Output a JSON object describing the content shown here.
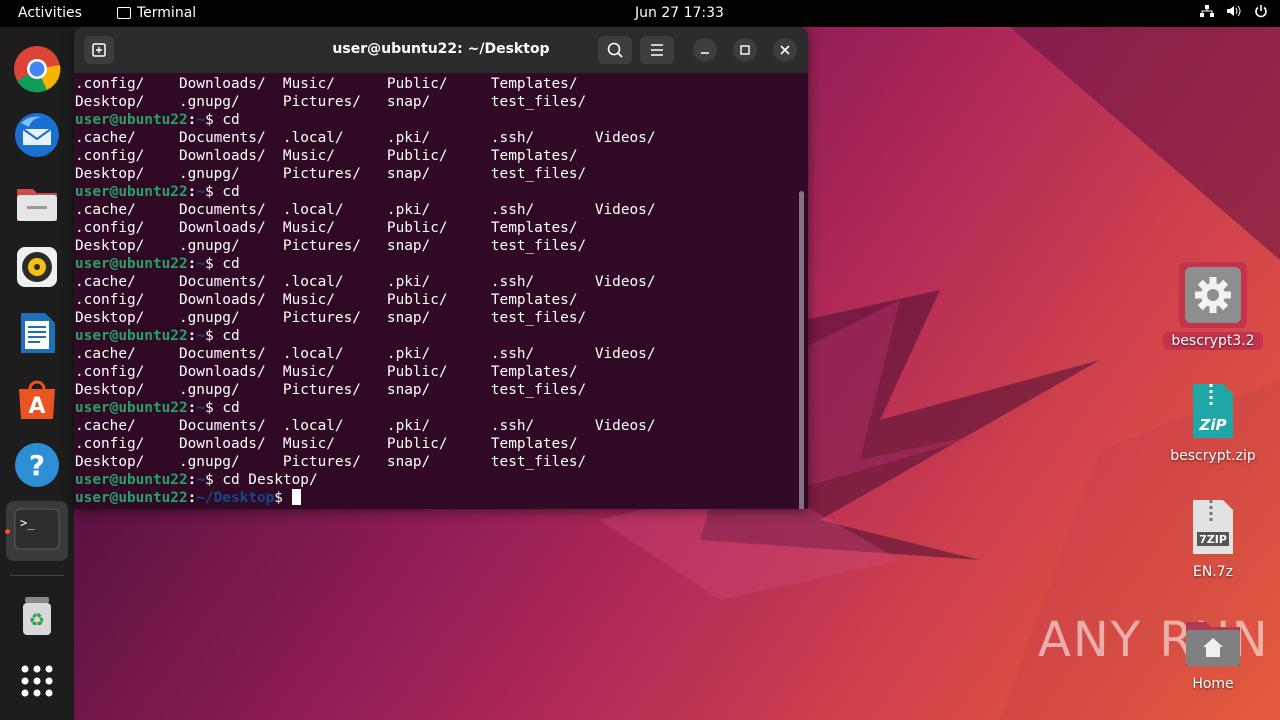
{
  "topbar": {
    "activities": "Activities",
    "app_name": "Terminal",
    "clock": "Jun 27  17:33",
    "tray_icons": [
      "network-icon",
      "volume-icon",
      "power-icon"
    ]
  },
  "dock": {
    "items": [
      "chrome",
      "thunderbird",
      "files",
      "rhythmbox",
      "libreoffice-writer",
      "app-center",
      "help",
      "terminal",
      "trash",
      "show-apps"
    ]
  },
  "terminal": {
    "title": "user@ubuntu22: ~/Desktop",
    "prompt_user": "user@ubuntu22",
    "lines": [
      {
        "type": "out",
        "text": ".config/    Downloads/  Music/      Public/     Templates/"
      },
      {
        "type": "out",
        "text": "Desktop/    .gnupg/     Pictures/   snap/       test_files/"
      },
      {
        "type": "cmd",
        "path": "~",
        "cmd": "cd"
      },
      {
        "type": "out",
        "text": ".cache/     Documents/  .local/     .pki/       .ssh/       Videos/"
      },
      {
        "type": "out",
        "text": ".config/    Downloads/  Music/      Public/     Templates/"
      },
      {
        "type": "out",
        "text": "Desktop/    .gnupg/     Pictures/   snap/       test_files/"
      },
      {
        "type": "cmd",
        "path": "~",
        "cmd": "cd"
      },
      {
        "type": "out",
        "text": ".cache/     Documents/  .local/     .pki/       .ssh/       Videos/"
      },
      {
        "type": "out",
        "text": ".config/    Downloads/  Music/      Public/     Templates/"
      },
      {
        "type": "out",
        "text": "Desktop/    .gnupg/     Pictures/   snap/       test_files/"
      },
      {
        "type": "cmd",
        "path": "~",
        "cmd": "cd"
      },
      {
        "type": "out",
        "text": ".cache/     Documents/  .local/     .pki/       .ssh/       Videos/"
      },
      {
        "type": "out",
        "text": ".config/    Downloads/  Music/      Public/     Templates/"
      },
      {
        "type": "out",
        "text": "Desktop/    .gnupg/     Pictures/   snap/       test_files/"
      },
      {
        "type": "cmd",
        "path": "~",
        "cmd": "cd"
      },
      {
        "type": "out",
        "text": ".cache/     Documents/  .local/     .pki/       .ssh/       Videos/"
      },
      {
        "type": "out",
        "text": ".config/    Downloads/  Music/      Public/     Templates/"
      },
      {
        "type": "out",
        "text": "Desktop/    .gnupg/     Pictures/   snap/       test_files/"
      },
      {
        "type": "cmd",
        "path": "~",
        "cmd": "cd"
      },
      {
        "type": "out",
        "text": ".cache/     Documents/  .local/     .pki/       .ssh/       Videos/"
      },
      {
        "type": "out",
        "text": ".config/    Downloads/  Music/      Public/     Templates/"
      },
      {
        "type": "out",
        "text": "Desktop/    .gnupg/     Pictures/   snap/       test_files/"
      },
      {
        "type": "cmd",
        "path": "~",
        "cmd": "cd Desktop/"
      },
      {
        "type": "cmd",
        "path": "~/Desktop",
        "cmd": "",
        "cursor": true
      }
    ]
  },
  "desktop": {
    "icons": [
      {
        "label": "bescrypt3.2",
        "kind": "gear-icon",
        "selected": true
      },
      {
        "label": "bescrypt.zip",
        "kind": "zip-icon",
        "selected": false
      },
      {
        "label": "EN.7z",
        "kind": "7zip-icon",
        "selected": false
      },
      {
        "label": "Home",
        "kind": "home-folder-icon",
        "selected": false
      }
    ]
  },
  "watermark": "ANY RUN",
  "colors": {
    "terminal_bg": "#300a24",
    "prompt_user": "#26a269",
    "prompt_path": "#12488b",
    "accent": "#e95420"
  }
}
